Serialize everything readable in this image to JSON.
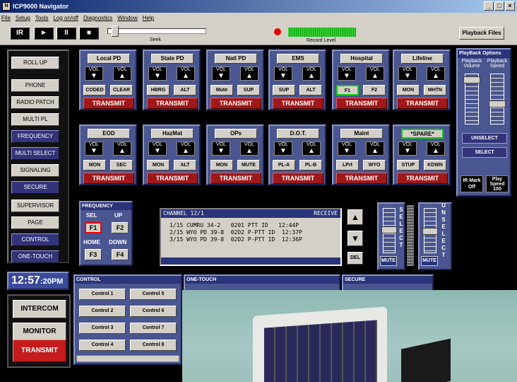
{
  "window": {
    "title": "ICP9000 Navigator",
    "controls": [
      "_",
      "□",
      "×"
    ]
  },
  "menu": [
    "File",
    "Setup",
    "Tools",
    "Log on/off",
    "Diagnostics",
    "Window",
    "Help"
  ],
  "toolbar": {
    "buttons": [
      "IR",
      "►",
      "II",
      "■"
    ],
    "seek_label": "Seek",
    "record_label": "Record Level",
    "playback_files": "Playback Files"
  },
  "left": {
    "buttons": [
      "ROLL UP",
      "PHONE",
      "RADIO PATCH",
      "MULTI PL",
      "FREQUENCY",
      "MULTI SELECT",
      "SIGNALING",
      "SECURE",
      "SUPERVISOR",
      "PAGE",
      "CONTROL",
      "ONE-TOUCH"
    ],
    "clock": "12:57",
    "clock_suffix": ":20PM",
    "intercom": "INTERCOM",
    "monitor": "MONITOR",
    "transmit": "TRANSMIT"
  },
  "channels": [
    {
      "title": "Local PD",
      "b1": "CODED",
      "b2": "CLEAR"
    },
    {
      "title": "State PD",
      "b1": "HBRG",
      "b2": "ALT"
    },
    {
      "title": "Natl PD",
      "b1": "Mute",
      "b2": "SUP"
    },
    {
      "title": "EMS",
      "b1": "SUP",
      "b2": "ALT"
    },
    {
      "title": "Hospital",
      "b1": "F1",
      "b2": "F2"
    },
    {
      "title": "Lifeline",
      "b1": "MON",
      "b2": "MHTN"
    },
    {
      "title": "EOD",
      "b1": "MON",
      "b2": "SEC"
    },
    {
      "title": "HazMat",
      "b1": "MON",
      "b2": "ALT"
    },
    {
      "title": "OPs",
      "b1": "MON",
      "b2": "MUTE"
    },
    {
      "title": "D.O.T.",
      "b1": "PL-A",
      "b2": "PL-B"
    },
    {
      "title": "Maint",
      "b1": "LPrt",
      "b2": "WYO"
    },
    {
      "title": "*SPARE*",
      "b1": "STUP",
      "b2": "KDWN"
    }
  ],
  "vol": "VOL",
  "transmit": "TRANSMIT",
  "playback": {
    "title": "PlayBack Options",
    "volume": "Playback Volume",
    "speed": "Playback Speed",
    "unselect": "UNSELECT",
    "select": "SELECT",
    "mark": "IR Mark Off",
    "play_speed": "Play Speed 100"
  },
  "frequency": {
    "title": "FREQUENCY",
    "sel": "SEL",
    "up": "UP",
    "home": "HOME",
    "down": "DOWN",
    "buttons": [
      "F1",
      "F2",
      "F3",
      "F4"
    ]
  },
  "channel_display": {
    "header": "CHANNEL 12/1",
    "status": "RECEIVE",
    "rows": [
      "1/15 CUMRU 34-2   0201 PTT ID   12:44P",
      "2/15 WYO PD 39-8  02D2 P-PTT ID  12:37P",
      "3/15 WYO PD 39-8  02D2 P-PTT ID  12:36P"
    ],
    "del": "DEL"
  },
  "select_slider": {
    "label": "SELECT",
    "mute": "MUTE"
  },
  "unselect_slider": {
    "label": "UNSELECT",
    "mute": "MUTE"
  },
  "control": {
    "title": "CONTROL",
    "buttons": [
      "Control 1",
      "Control 5",
      "Control 2",
      "Control 6",
      "Control 3",
      "Control 7",
      "Control 4",
      "Control 8"
    ]
  },
  "one_touch": {
    "title": "ONE-TOUCH"
  },
  "secure": {
    "title": "SECURE"
  }
}
